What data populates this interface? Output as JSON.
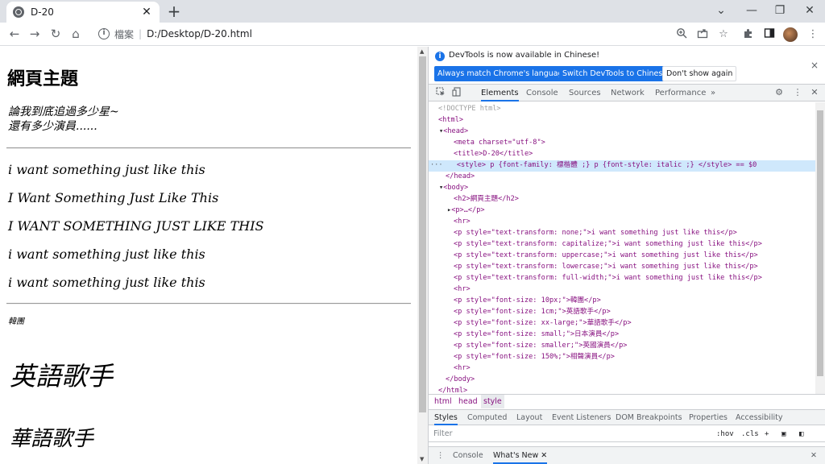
{
  "browser": {
    "tab_title": "D-20",
    "tab_close": "✕",
    "new_tab": "+",
    "window_controls": [
      "⌄",
      "—",
      "❐",
      "✕"
    ],
    "nav": {
      "back": "←",
      "forward": "→",
      "reload": "↻",
      "home": "⌂"
    },
    "address": {
      "label": "檔案",
      "url": "D:/Desktop/D-20.html"
    },
    "toolbar_icons": [
      "zoom-icon",
      "share-icon",
      "star-icon",
      "extensions-icon",
      "sidepanel-icon",
      "avatar",
      "menu-icon"
    ]
  },
  "page": {
    "heading": "網頁主題",
    "poem": [
      "論我到底追過多少星~",
      "還有多少演員......"
    ],
    "lines": [
      "i want something just like this",
      "I Want Something Just Like This",
      "I WANT SOMETHING JUST LIKE THIS",
      "i want something just like this",
      "i want something just like this"
    ],
    "small": "韓團",
    "big1": "英語歌手",
    "big2": "華語歌手"
  },
  "devtools": {
    "info_message": "DevTools is now available in Chinese!",
    "btn_match": "Always match Chrome's language",
    "btn_switch": "Switch DevTools to Chinese",
    "btn_dont": "Don't show again",
    "info_close": "×",
    "tabs": [
      "Elements",
      "Console",
      "Sources",
      "Network",
      "Performance",
      "»"
    ],
    "elements": [
      "<!DOCTYPE html>",
      "<html>",
      "<head>",
      "<meta charset=\"utf-8\">",
      "<title>D-20</title>",
      "<style> p {font-family: 標楷體 ;} p {font-style: italic ;} </style> == $0",
      "</head>",
      "<body>",
      "<h2>網頁主題</h2>",
      "<p>…</p>",
      "<hr>",
      "<p style=\"text-transform: none;\">i want something just like this</p>",
      "<p style=\"text-transform: capitalize;\">i want something just like this</p>",
      "<p style=\"text-transform: uppercase;\">i want something just like this</p>",
      "<p style=\"text-transform: lowercase;\">i want something just like this</p>",
      "<p style=\"text-transform: full-width;\">i want something just like this</p>",
      "<hr>",
      "<p style=\"font-size: 10px;\">韓團</p>",
      "<p style=\"font-size: 1cm;\">英語歌手</p>",
      "<p style=\"font-size: xx-large;\">華語歌手</p>",
      "<p style=\"font-size: small;\">日本演員</p>",
      "<p style=\"font-size: smaller;\">英國演員</p>",
      "<p style=\"font-size: 150%;\">相聲演員</p>",
      "<hr>",
      "</body>",
      "</html>"
    ],
    "breadcrumbs": [
      "html",
      "head",
      "style"
    ],
    "styles_tabs": [
      "Styles",
      "Computed",
      "Layout",
      "Event Listeners",
      "DOM Breakpoints",
      "Properties",
      "Accessibility"
    ],
    "filter_placeholder": "Filter",
    "filter_hov": ":hov",
    "filter_cls": ".cls",
    "drawer_tabs": [
      "Console",
      "What's New"
    ],
    "drawer_close": "✕"
  }
}
